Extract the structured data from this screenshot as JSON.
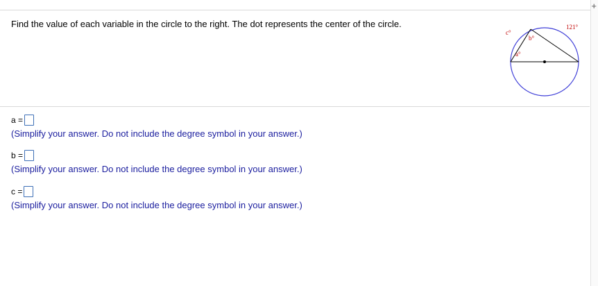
{
  "question": {
    "instructions": "Find the value of each variable in the circle to the right. The dot represents the center of the circle."
  },
  "figure": {
    "arc_label": "121°",
    "label_a": "a°",
    "label_b": "b°",
    "label_c": "c°",
    "colors": {
      "circle": "#4040d8",
      "label": "#c00000",
      "lines": "#000000"
    }
  },
  "answers": [
    {
      "label": "a =",
      "value": "",
      "hint": "(Simplify your answer. Do not include the degree symbol in your answer.)"
    },
    {
      "label": "b =",
      "value": "",
      "hint": "(Simplify your answer. Do not include the degree symbol in your answer.)"
    },
    {
      "label": "c =",
      "value": "",
      "hint": "(Simplify your answer. Do not include the degree symbol in your answer.)"
    }
  ]
}
